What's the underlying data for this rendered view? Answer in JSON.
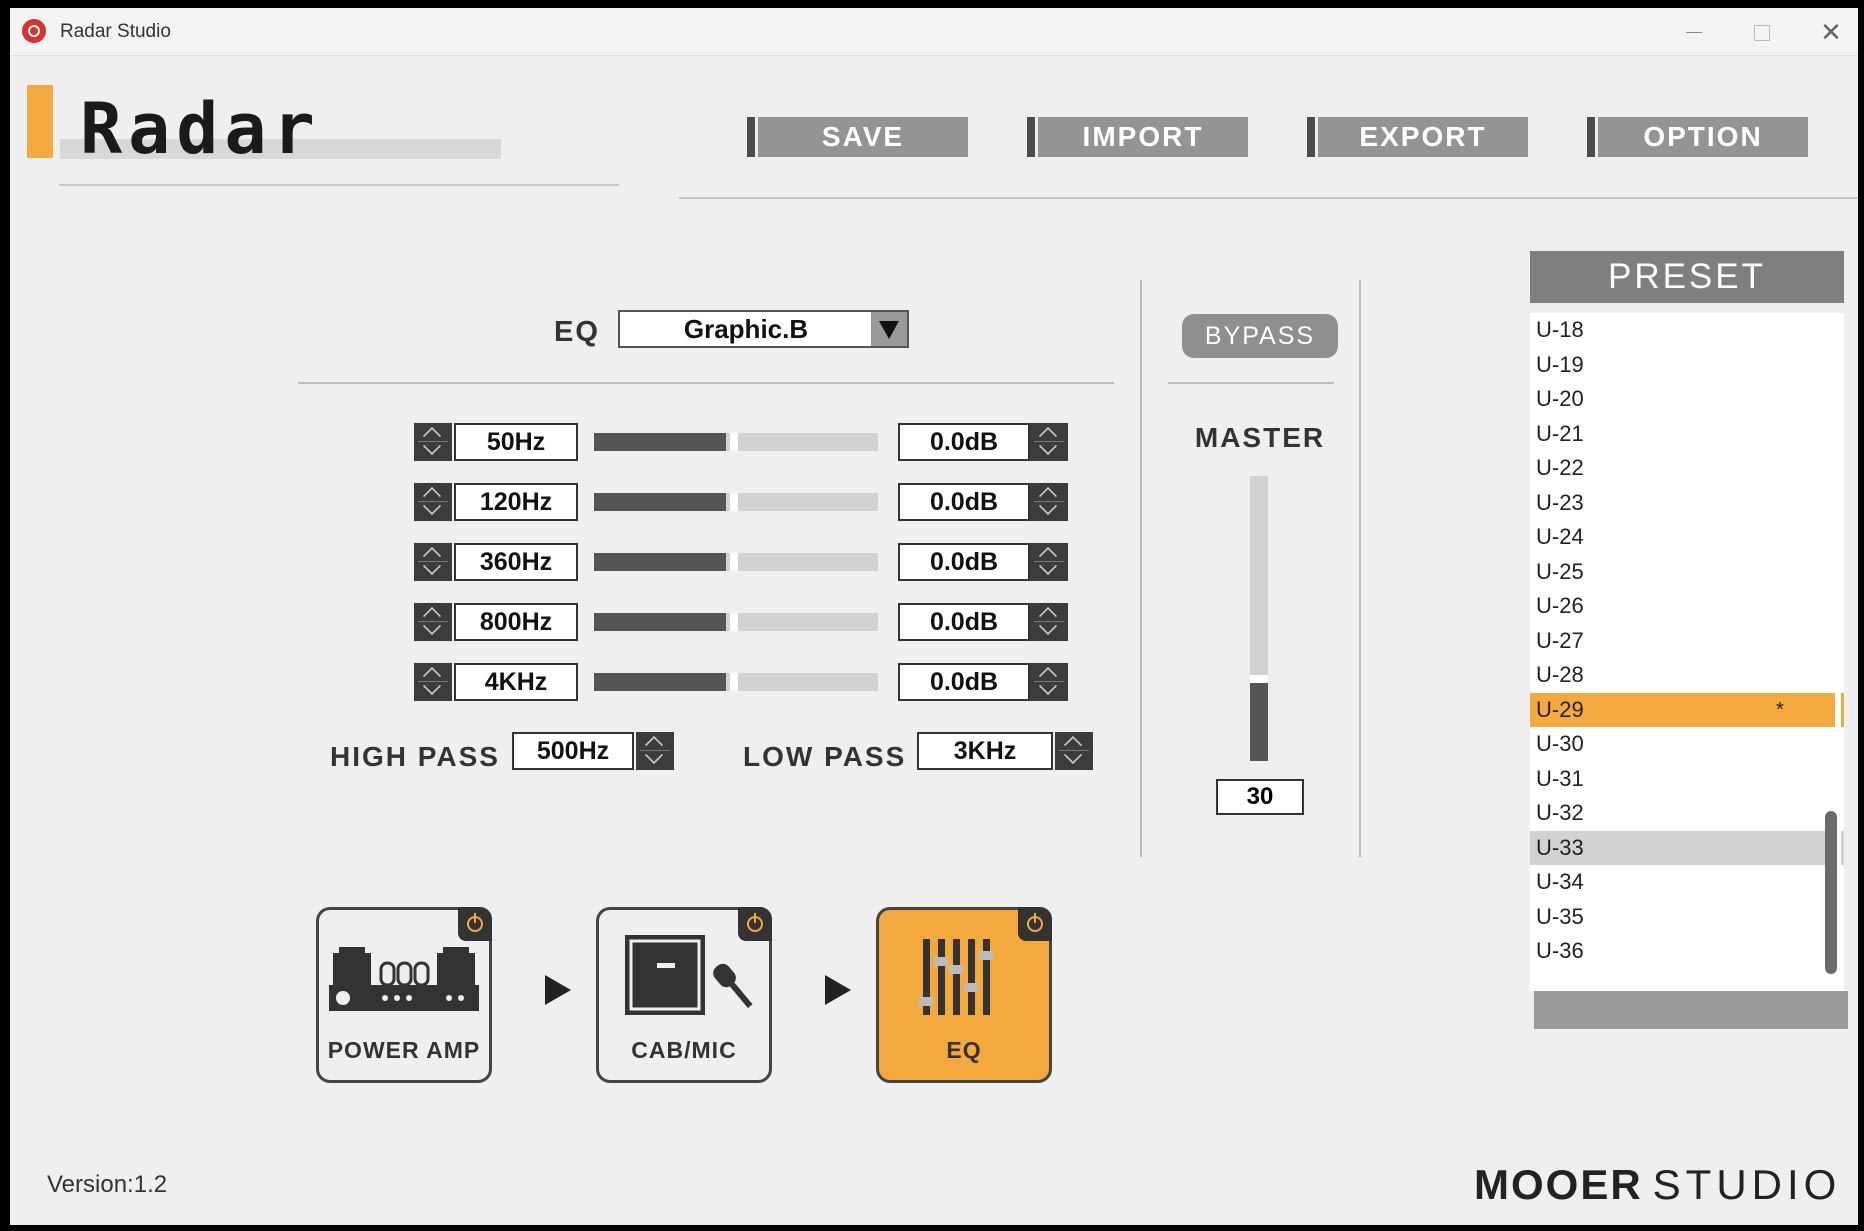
{
  "window": {
    "title": "Radar Studio"
  },
  "header": {
    "logo_text": "Radar",
    "buttons": [
      "SAVE",
      "IMPORT",
      "EXPORT",
      "OPTION"
    ]
  },
  "eq": {
    "label": "EQ",
    "type": "Graphic.B",
    "bands": [
      {
        "freq": "50Hz",
        "gain": "0.0dB",
        "level": 0.5
      },
      {
        "freq": "120Hz",
        "gain": "0.0dB",
        "level": 0.5
      },
      {
        "freq": "360Hz",
        "gain": "0.0dB",
        "level": 0.5
      },
      {
        "freq": "800Hz",
        "gain": "0.0dB",
        "level": 0.5
      },
      {
        "freq": "4KHz",
        "gain": "0.0dB",
        "level": 0.5
      }
    ],
    "high_pass_label": "HIGH PASS",
    "high_pass_value": "500Hz",
    "low_pass_label": "LOW PASS",
    "low_pass_value": "3KHz"
  },
  "master": {
    "bypass_label": "BYPASS",
    "label": "MASTER",
    "value": "30",
    "level": 0.3
  },
  "preset": {
    "title": "PRESET",
    "items": [
      "U-18",
      "U-19",
      "U-20",
      "U-21",
      "U-22",
      "U-23",
      "U-24",
      "U-25",
      "U-26",
      "U-27",
      "U-28",
      "U-29",
      "U-30",
      "U-31",
      "U-32",
      "U-33",
      "U-34",
      "U-35",
      "U-36"
    ],
    "selected": "U-29",
    "selected_marker": "*",
    "hovered": "U-33"
  },
  "chain": {
    "modules": [
      {
        "label": "POWER AMP",
        "icon": "power-amp-icon",
        "active": false
      },
      {
        "label": "CAB/MIC",
        "icon": "cab-mic-icon",
        "active": false
      },
      {
        "label": "EQ",
        "icon": "eq-sliders-icon",
        "active": true
      }
    ]
  },
  "footer": {
    "version": "Version:1.2",
    "brand_main": "MOOER",
    "brand_sub": "STUDIO"
  },
  "colors": {
    "accent": "#f4a93f",
    "button": "#949494",
    "dark": "#3c3c3c"
  }
}
